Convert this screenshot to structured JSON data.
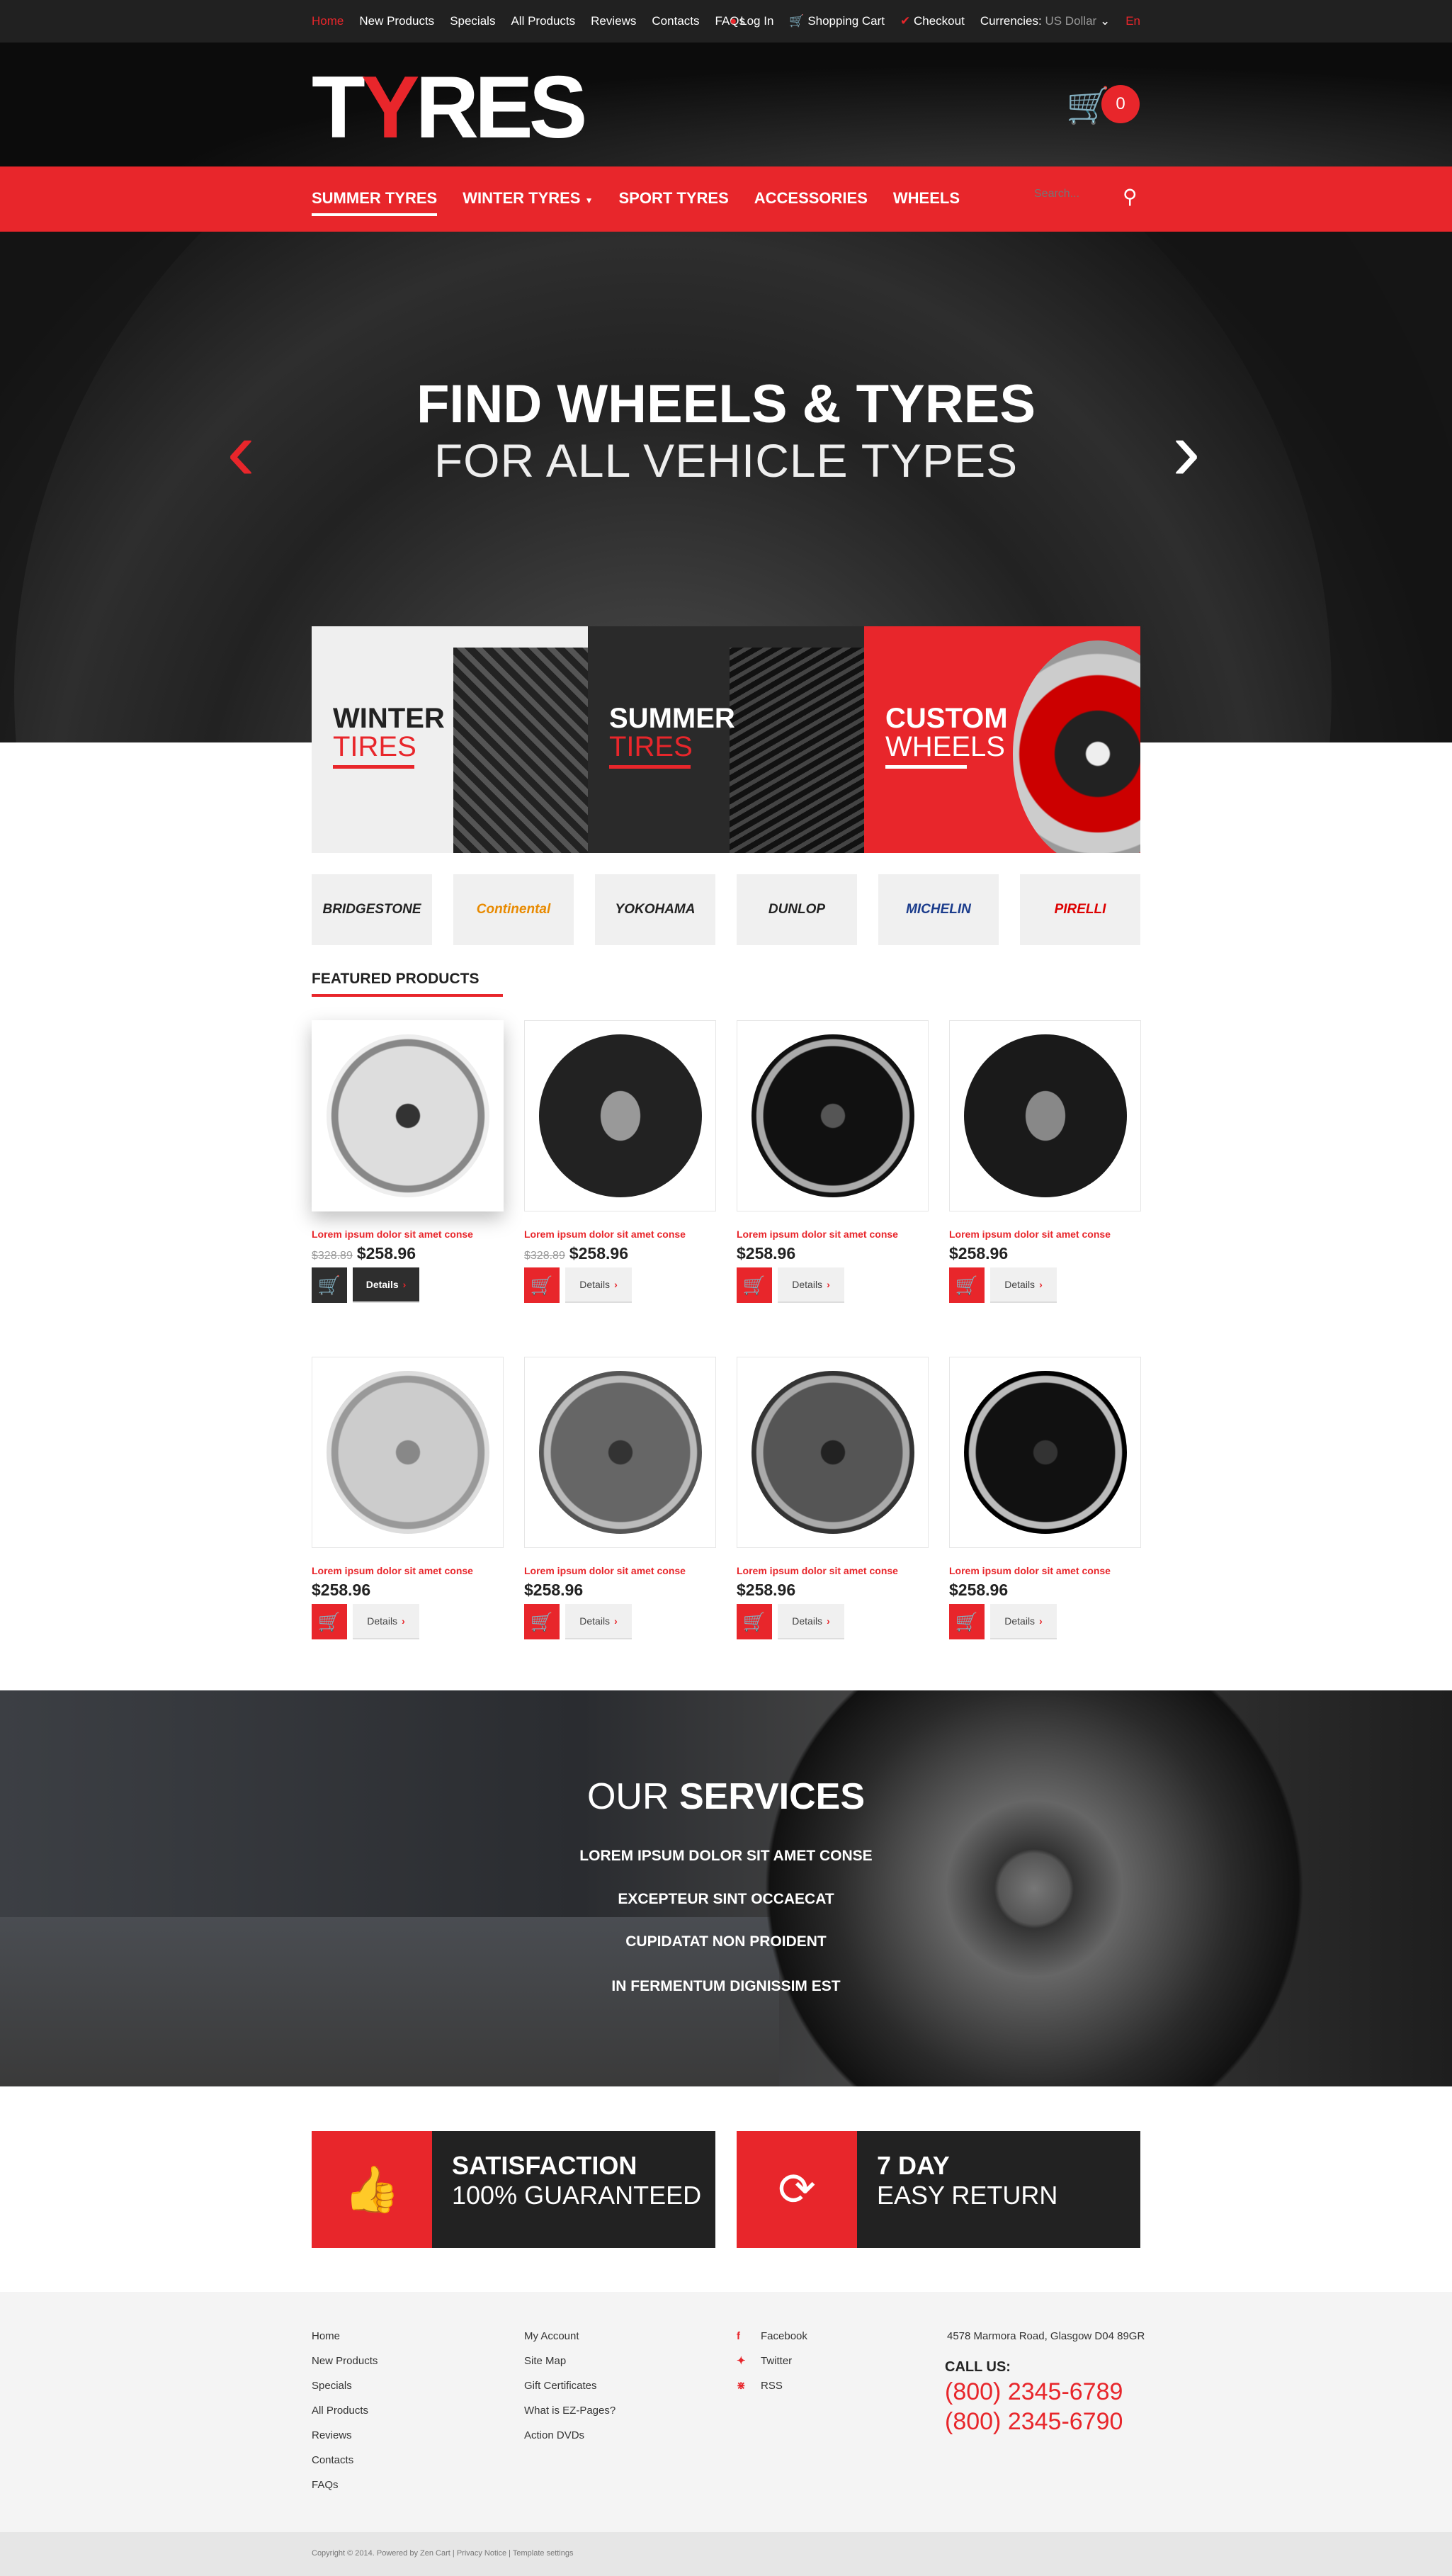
{
  "topbar": {
    "links": [
      "Home",
      "New Products",
      "Specials",
      "All Products",
      "Reviews",
      "Contacts",
      "FAQs"
    ],
    "login": "Log In",
    "cart": "Shopping Cart",
    "checkout": "Checkout",
    "currencies_label": "Currencies:",
    "currency": "US Dollar",
    "language": "En"
  },
  "header": {
    "logo_a": "T",
    "logo_b": "Y",
    "logo_c": "RES",
    "cart_count": "0"
  },
  "nav": {
    "items": [
      "SUMMER TYRES",
      "WINTER TYRES",
      "SPORT TYRES",
      "ACCESSORIES",
      "WHEELS"
    ],
    "search_placeholder": "Search..."
  },
  "hero": {
    "title": "FIND WHEELS & TYRES",
    "subtitle": "FOR ALL VEHICLE TYPES"
  },
  "banners": [
    {
      "a": "WINTER",
      "b": "TIRES"
    },
    {
      "a": "SUMMER",
      "b": "TIRES"
    },
    {
      "a": "CUSTOM",
      "b": "WHEELS"
    }
  ],
  "brands": [
    "BRIDGESTONE",
    "Continental",
    "YOKOHAMA",
    "DUNLOP",
    "MICHELIN",
    "PIRELLI"
  ],
  "featured": {
    "title": "FEATURED PRODUCTS",
    "details": "Details",
    "products": [
      {
        "title": "Lorem ipsum dolor sit amet conse",
        "old": "$328.89",
        "price": "$258.96"
      },
      {
        "title": "Lorem ipsum dolor sit amet conse",
        "old": "$328.89",
        "price": "$258.96"
      },
      {
        "title": "Lorem ipsum dolor sit amet conse",
        "old": "",
        "price": "$258.96"
      },
      {
        "title": "Lorem ipsum dolor sit amet conse",
        "old": "",
        "price": "$258.96"
      },
      {
        "title": "Lorem ipsum dolor sit amet conse",
        "old": "",
        "price": "$258.96"
      },
      {
        "title": "Lorem ipsum dolor sit amet conse",
        "old": "",
        "price": "$258.96"
      },
      {
        "title": "Lorem ipsum dolor sit amet conse",
        "old": "",
        "price": "$258.96"
      },
      {
        "title": "Lorem ipsum dolor sit amet conse",
        "old": "",
        "price": "$258.96"
      }
    ]
  },
  "services": {
    "title_a": "OUR",
    "title_b": "SERVICES",
    "items": [
      "LOREM IPSUM DOLOR SIT AMET CONSE",
      "EXCEPTEUR SINT OCCAECAT",
      "CUPIDATAT NON PROIDENT",
      "IN FERMENTUM DIGNISSIM EST"
    ]
  },
  "promo": [
    {
      "a": "SATISFACTION",
      "b": "100% GUARANTEED",
      "icon": "thumbs-up-icon"
    },
    {
      "a": "7 DAY",
      "b": "EASY RETURN",
      "icon": "refresh-icon"
    }
  ],
  "footer": {
    "col1": [
      "Home",
      "New Products",
      "Specials",
      "All Products",
      "Reviews",
      "Contacts",
      "FAQs"
    ],
    "col2": [
      "My Account",
      "Site Map",
      "Gift Certificates",
      "What is EZ-Pages?",
      "Action DVDs"
    ],
    "social": [
      "Facebook",
      "Twitter",
      "RSS"
    ],
    "address": "4578 Marmora Road, Glasgow D04 89GR",
    "call_label": "CALL US:",
    "phones": [
      "(800) 2345-6789",
      "(800) 2345-6790"
    ],
    "copyright": "Copyright © 2014. Powered by Zen Cart",
    "privacy": "Privacy Notice",
    "template": "Template settings"
  },
  "colors": {
    "accent": "#e8262b",
    "dark": "#212121"
  }
}
